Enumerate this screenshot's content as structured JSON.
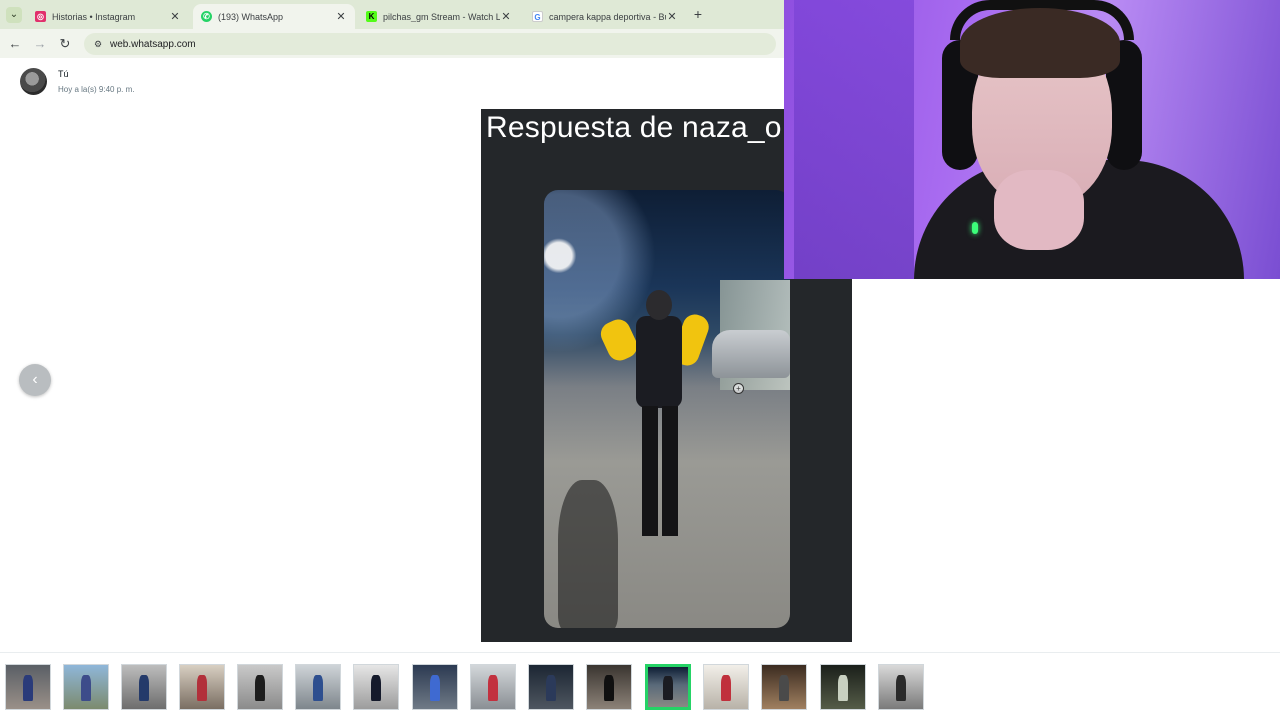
{
  "browser": {
    "tabs": [
      {
        "title": "Historias • Instagram",
        "favicon": "instagram-icon",
        "color": "#e1306c",
        "active": false
      },
      {
        "title": "(193) WhatsApp",
        "favicon": "whatsapp-icon",
        "color": "#25d366",
        "active": true
      },
      {
        "title": "pilchas_gm Stream - Watch Live",
        "favicon": "kick-icon",
        "color": "#53fc18",
        "active": false
      },
      {
        "title": "campera kappa deportiva - Bus",
        "favicon": "google-icon",
        "color": "#4285f4",
        "active": false
      }
    ],
    "url": "web.whatsapp.com"
  },
  "viewer": {
    "sender_name": "Tú",
    "timestamp": "Hoy a la(s) 9:40 p. m.",
    "caption": "Respuesta de naza_o"
  },
  "thumbnails": {
    "count": 16,
    "selected_index": 11,
    "accent": "#25d366"
  },
  "colors": {
    "tab_strip": "#dfe9d6",
    "toolbar": "#f1f4ed",
    "media_background": "#24272a",
    "webcam_light": "#a86bf0"
  }
}
